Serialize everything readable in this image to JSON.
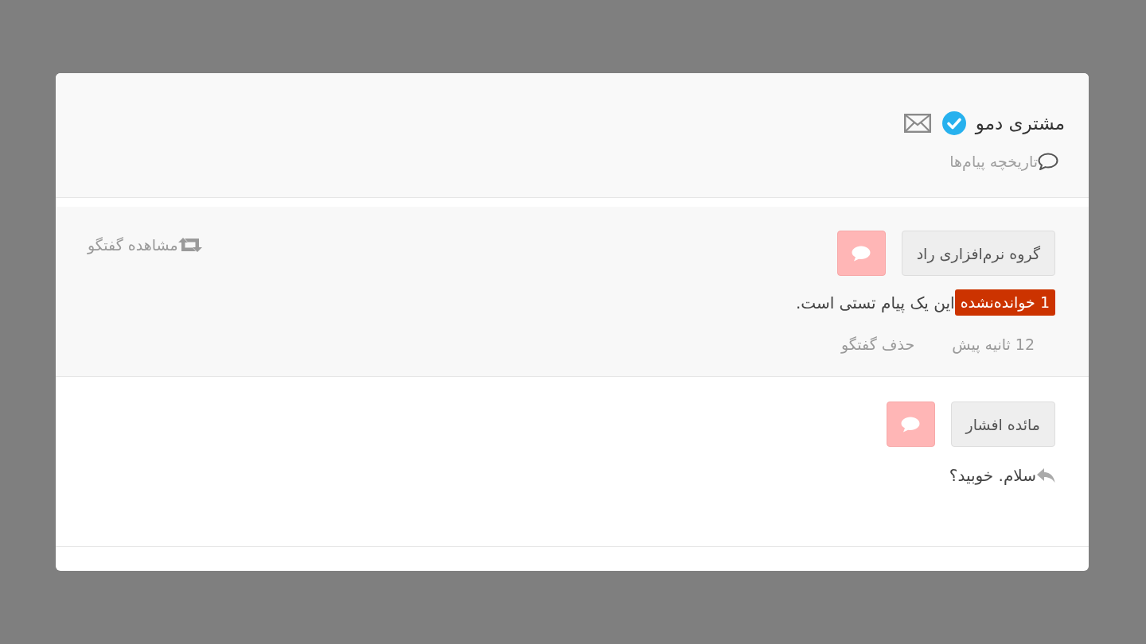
{
  "header": {
    "title": "مشتری دمو",
    "verified": true,
    "history_link": "تاریخچه پیام‌ها"
  },
  "conversations": [
    {
      "sender": "گروه نرم‌افزاری راد",
      "unread": true,
      "view_link": "مشاهده گفتگو",
      "unread_badge": "1 خوانده‌نشده",
      "message": "این یک پیام تستی است.",
      "replied": false,
      "time": "12 ثانیه پیش",
      "delete_link": "حذف گفتگو"
    },
    {
      "sender": "مائده افشار",
      "unread": false,
      "message": "سلام. خوبید؟",
      "replied": true
    }
  ]
}
